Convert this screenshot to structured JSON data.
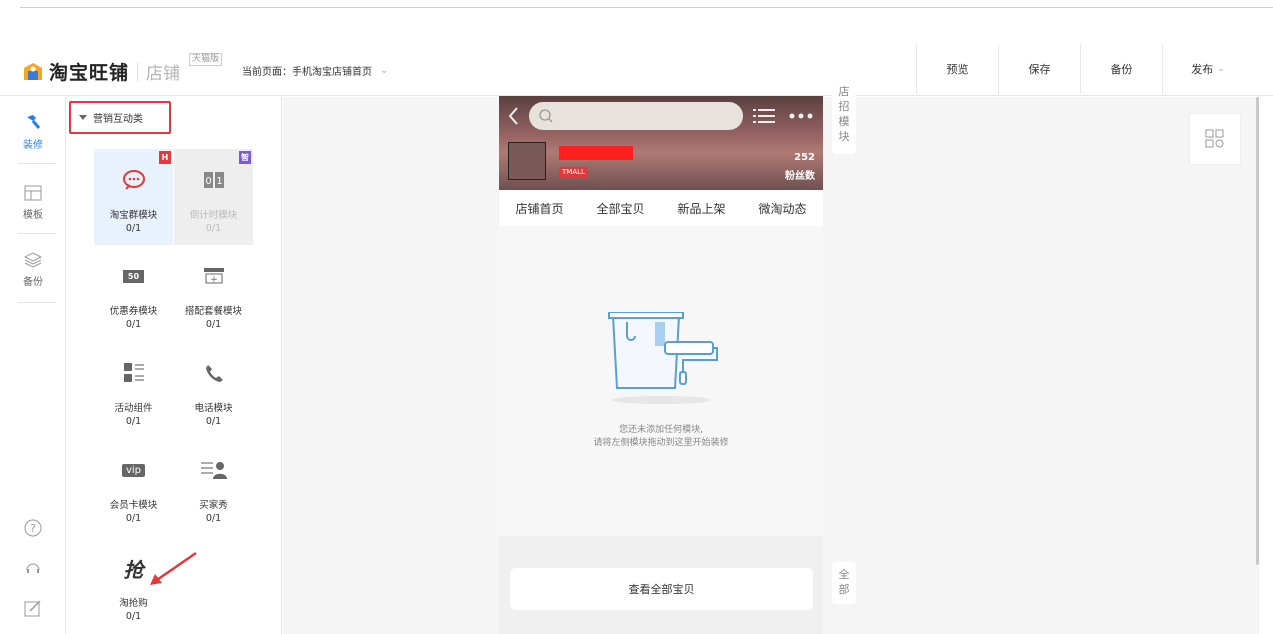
{
  "header": {
    "logo_text": "淘宝旺铺",
    "logo_sub": "店铺",
    "edition": "天猫版",
    "current_page_label": "当前页面：",
    "current_page_value": "手机淘宝店铺首页",
    "buttons": [
      "预览",
      "保存",
      "备份",
      "发布"
    ]
  },
  "rail": {
    "items": [
      {
        "label": "装修",
        "icon": "hammer-icon",
        "active": true
      },
      {
        "label": "模板",
        "icon": "template-icon"
      },
      {
        "label": "备份",
        "icon": "layers-icon"
      }
    ],
    "bottom_icons": [
      "help-icon",
      "headset-icon",
      "edit-icon"
    ]
  },
  "panel": {
    "category": "营销互动类",
    "modules": [
      {
        "name": "淘宝群模块",
        "count": "0/1",
        "icon": "chat-group-icon",
        "badge": "H",
        "badge_color": "#e4393c"
      },
      {
        "name": "倒计时模块",
        "count": "0/1",
        "icon": "countdown-icon",
        "badge": "智",
        "badge_color": "#7b5bd6"
      },
      {
        "name": "优惠券模块",
        "count": "0/1",
        "icon": "coupon-icon",
        "icon_text": "50"
      },
      {
        "name": "搭配套餐模块",
        "count": "0/1",
        "icon": "bundle-icon"
      },
      {
        "name": "活动组件",
        "count": "0/1",
        "icon": "activity-icon"
      },
      {
        "name": "电话模块",
        "count": "0/1",
        "icon": "phone-icon"
      },
      {
        "name": "会员卡模块",
        "count": "0/1",
        "icon": "vip-card-icon",
        "icon_text": "vip"
      },
      {
        "name": "买家秀",
        "count": "0/1",
        "icon": "buyer-show-icon"
      },
      {
        "name": "淘抢购",
        "count": "0/1",
        "icon": "flash-sale-icon",
        "icon_text": "抢"
      }
    ]
  },
  "phone": {
    "store_tag": "TMALL",
    "fans_count": "252",
    "fans_label": "粉丝数",
    "tabs": [
      "店铺首页",
      "全部宝贝",
      "新品上架",
      "微淘动态"
    ],
    "empty_line1": "您还未添加任何模块,",
    "empty_line2": "请将左侧模块拖动到这里开始装修",
    "view_all": "查看全部宝贝"
  },
  "side_tabs": {
    "top": "店招模块",
    "bottom": "全部"
  }
}
